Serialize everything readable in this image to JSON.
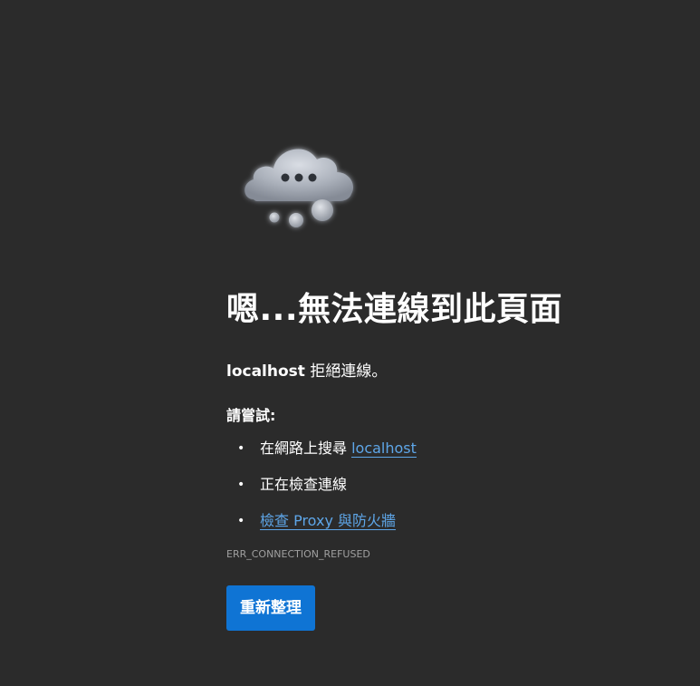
{
  "icon": {
    "name": "thinking-cloud-icon"
  },
  "error": {
    "title": "嗯...無法連線到此頁面",
    "host": "localhost",
    "message": "拒絕連線。",
    "try_heading": "請嘗試:",
    "suggestions": [
      {
        "prefix": "在網路上搜尋 ",
        "link": "localhost"
      },
      {
        "text": "正在檢查連線"
      },
      {
        "link": "檢查 Proxy 與防火牆"
      }
    ],
    "code": "ERR_CONNECTION_REFUSED",
    "reload_label": "重新整理"
  },
  "colors": {
    "background": "#2b2b2b",
    "link": "#5ea6e8",
    "button": "#0f74d4"
  }
}
